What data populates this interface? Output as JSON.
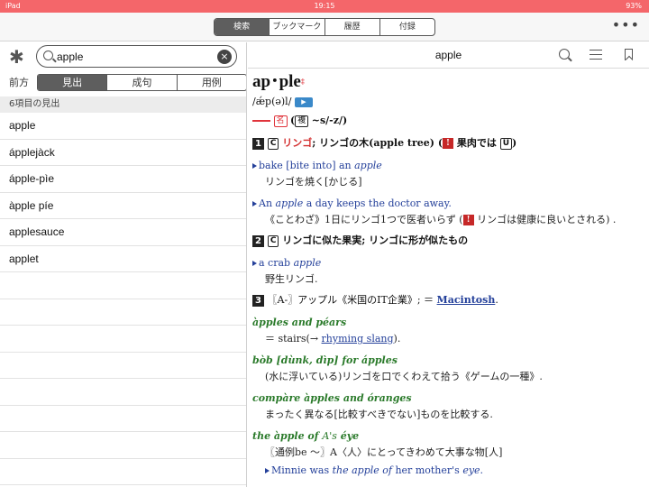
{
  "status": {
    "left": "iPad",
    "time": "19:15",
    "battery": "93%"
  },
  "tabs": [
    {
      "label": "検索",
      "active": true
    },
    {
      "label": "ブックマーク",
      "active": false
    },
    {
      "label": "履歴",
      "active": false
    },
    {
      "label": "付録",
      "active": false
    }
  ],
  "more_label": "•••",
  "left": {
    "asterisk": "✱",
    "search_value": "apple",
    "clear_label": "×",
    "mode_prefix": "前方",
    "modes": [
      {
        "label": "見出",
        "active": true
      },
      {
        "label": "成句",
        "active": false
      },
      {
        "label": "用例",
        "active": false
      }
    ],
    "count_label": "6項目の見出",
    "results": [
      "apple",
      "ápplejàck",
      "ápple-pìe",
      "àpple píe",
      "applesauce",
      "applet"
    ]
  },
  "right": {
    "title": "apple",
    "headword": "ap･ple",
    "headword_mark": "‡",
    "pronunciation": "/ǽp(ə)l/",
    "play_label": "▶",
    "pos_noun": "名",
    "pos_plural": "複",
    "pos_plural_form": "~s/-z/)",
    "sense1_num": "1",
    "sense1_countable": "C",
    "sense1_text_red": "リンゴ",
    "sense1_text": "; リンゴの木(apple tree) (",
    "sense1_note": "果肉では",
    "sense1_uncount": "U",
    "ex1_en_pre": "bake [bite into] an ",
    "ex1_en_it": "apple",
    "ex1_tr": "リンゴを焼く[かじる]",
    "ex2_en_pre": "An ",
    "ex2_en_it": "apple",
    "ex2_en_post": " a day keeps the doctor away.",
    "ex2_tr_pre": "《ことわざ》1日にリンゴ1つで医者いらず (",
    "ex2_tr_post": "リンゴは健康に良いとされる) .",
    "sense2_num": "2",
    "sense2_countable": "C",
    "sense2_text": "リンゴに似た果実; リンゴに形が似たもの",
    "ex3_en_pre": "a crab ",
    "ex3_en_it": "apple",
    "ex3_tr": "野生リンゴ.",
    "sense3_num": "3",
    "sense3_text": "〖A-〗アップル《米国のIT企業》; ＝",
    "sense3_link": "Macintosh",
    "sense3_end": ".",
    "phrase1": "àpples and péars",
    "phrase1_def_pre": "＝ stairs(→ ",
    "phrase1_link": "rhyming slang",
    "phrase1_def_post": ").",
    "phrase2": "bòb [dùnk, dìp] for ápples",
    "phrase2_def": "(水に浮いている)リンゴを口でくわえて拾う《ゲームの一種》.",
    "phrase3": "compàre àpples and óranges",
    "phrase3_def": "まったく異なる[比較すべきでない]ものを比較する.",
    "phrase4_pre": "the àpple of ",
    "phrase4_a": "A's",
    "phrase4_post": " éye",
    "phrase4_def": "〖通例be ～〗A〈人〉にとってきわめて大事な物[人]",
    "ex4_en_pre": "Minnie was ",
    "ex4_en_it": "the apple of",
    "ex4_en_mid": " her mother's ",
    "ex4_en_it2": "eye",
    "ex4_en_end": "."
  }
}
